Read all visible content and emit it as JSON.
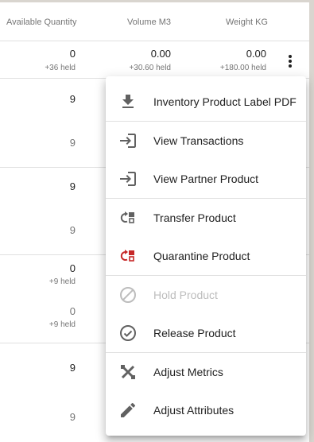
{
  "header": {
    "available_quantity": "Available Quantity",
    "volume": "Volume M3",
    "weight": "Weight KG"
  },
  "rows": [
    {
      "qty": "0",
      "qty_held": "+36 held",
      "volume": "0.00",
      "volume_held": "+30.60 held",
      "weight": "0.00",
      "weight_held": "+180.00 held"
    },
    {
      "qty": "9",
      "qty2": "9"
    },
    {
      "qty": "9",
      "qty2": "9"
    },
    {
      "qty": "0",
      "qty_held": "+9 held",
      "qty2": "0",
      "qty2_held": "+9 held"
    },
    {
      "qty": "9",
      "qty2": "9"
    }
  ],
  "menu": {
    "items": [
      {
        "label": "Inventory Product Label PDF",
        "icon": "download-icon",
        "enabled": true
      },
      {
        "label": "View Transactions",
        "icon": "login-icon",
        "enabled": true
      },
      {
        "label": "View Partner Product",
        "icon": "login-icon",
        "enabled": true
      },
      {
        "label": "Transfer Product",
        "icon": "transfer-icon",
        "enabled": true
      },
      {
        "label": "Quarantine Product",
        "icon": "quarantine-icon",
        "enabled": true,
        "icon_color": "#c62828"
      },
      {
        "label": "Hold Product",
        "icon": "block-icon",
        "enabled": false
      },
      {
        "label": "Release Product",
        "icon": "check-circle-icon",
        "enabled": true
      },
      {
        "label": "Adjust Metrics",
        "icon": "tools-icon",
        "enabled": true
      },
      {
        "label": "Adjust Attributes",
        "icon": "pencil-icon",
        "enabled": true
      }
    ]
  },
  "colors": {
    "icon": "#616161",
    "danger": "#c62828",
    "disabled": "#bdbdbd"
  }
}
